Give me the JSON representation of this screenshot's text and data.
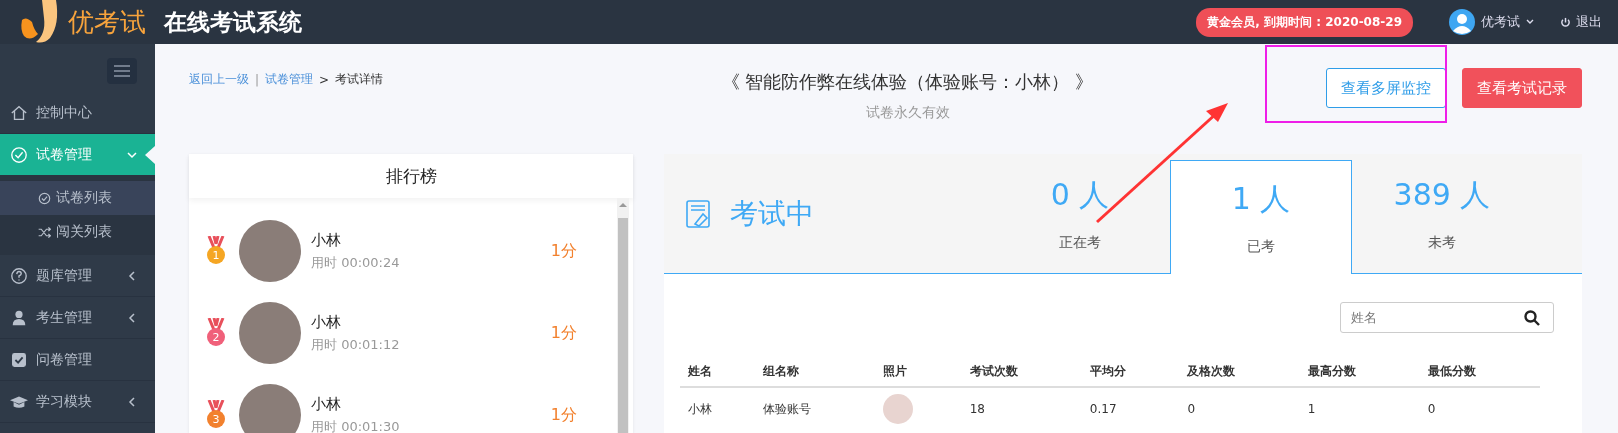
{
  "header": {
    "brand": "优考试",
    "system_title": "在线考试系统",
    "membership": "黄金会员, 到期时间 : 2020-08-29",
    "user": "优考试",
    "logout": "退出"
  },
  "sidebar": {
    "items": [
      {
        "label": "控制中心",
        "kind": "link",
        "selected": false
      },
      {
        "label": "试卷管理",
        "kind": "menu",
        "selected": true,
        "expanded": true,
        "children": [
          {
            "label": "试卷列表",
            "selected": true
          },
          {
            "label": "闯关列表",
            "selected": false
          }
        ]
      },
      {
        "label": "题库管理",
        "kind": "menu",
        "selected": false,
        "expanded": false
      },
      {
        "label": "考生管理",
        "kind": "menu",
        "selected": false,
        "expanded": false
      },
      {
        "label": "问卷管理",
        "kind": "link",
        "selected": false
      },
      {
        "label": "学习模块",
        "kind": "menu",
        "selected": false,
        "expanded": false
      }
    ]
  },
  "breadcrumb": {
    "back": "返回上一级",
    "separator": "|",
    "parent": "试卷管理",
    "arrow": ">",
    "current": "考试详情"
  },
  "exam": {
    "title": "《 智能防作弊在线体验（体验账号：小林） 》",
    "subtitle": "试卷永久有效"
  },
  "buttons": [
    {
      "label": "查看多屏监控",
      "kind": "outline"
    },
    {
      "label": "查看考试记录",
      "kind": "danger"
    }
  ],
  "ranking": {
    "title": "排行榜",
    "entries": [
      {
        "rank": "1",
        "color": "#f5a623",
        "name": "小林",
        "time": "用时 00:00:24",
        "score": "1分"
      },
      {
        "rank": "2",
        "color": "#f0607a",
        "name": "小林",
        "time": "用时 00:01:12",
        "score": "1分"
      },
      {
        "rank": "3",
        "color": "#f2812e",
        "name": "小林",
        "time": "用时 00:01:30",
        "score": "1分"
      }
    ]
  },
  "stats": {
    "title": "考试中",
    "tabs": [
      {
        "count": "0 人",
        "label": "正在考",
        "selected": false
      },
      {
        "count": "1 人",
        "label": "已考",
        "selected": true
      },
      {
        "count": "389 人",
        "label": "未考",
        "selected": false
      }
    ]
  },
  "search": {
    "placeholder": "姓名"
  },
  "table": {
    "columns": [
      "姓名",
      "组名称",
      "照片",
      "考试次数",
      "平均分",
      "及格次数",
      "最高分数",
      "最低分数"
    ],
    "rows": [
      [
        "小林",
        "体验账号",
        "",
        "18",
        "0.17",
        "0",
        "1",
        "0"
      ]
    ]
  }
}
